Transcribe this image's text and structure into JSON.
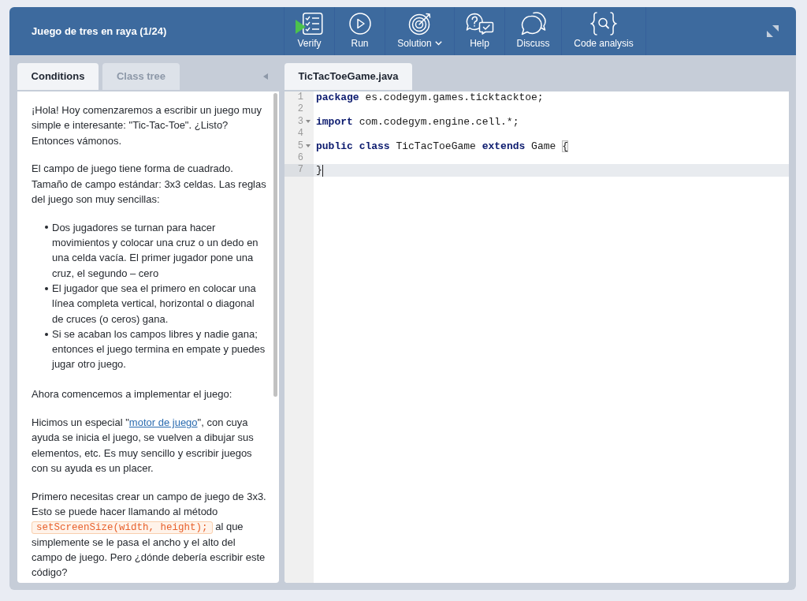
{
  "header": {
    "title": "Juego de tres en raya (1/24)",
    "toolbar": [
      {
        "label": "Verify",
        "kind": "verify",
        "dropdown": false
      },
      {
        "label": "Run",
        "kind": "run",
        "dropdown": false
      },
      {
        "label": "Solution",
        "kind": "solution",
        "dropdown": true
      },
      {
        "label": "Help",
        "kind": "help",
        "dropdown": false
      },
      {
        "label": "Discuss",
        "kind": "discuss",
        "dropdown": false
      },
      {
        "label": "Code analysis",
        "kind": "analysis",
        "dropdown": false
      }
    ]
  },
  "left_panel": {
    "tabs": [
      {
        "label": "Conditions",
        "selected": true
      },
      {
        "label": "Class tree",
        "selected": false
      }
    ],
    "content": [
      {
        "kind": "paragraph",
        "parts": [
          {
            "kind": "text",
            "text": "¡Hola! Hoy comenzaremos a escribir un juego muy simple e interesante: \"Tic-Tac-Toe\". ¿Listo? Entonces vámonos."
          }
        ]
      },
      {
        "kind": "paragraph",
        "parts": [
          {
            "kind": "text",
            "text": "El campo de juego tiene forma de cuadrado. Tamaño de campo estándar: 3x3 celdas. Las reglas del juego son muy sencillas:"
          }
        ]
      },
      {
        "kind": "list",
        "items": [
          "Dos jugadores se turnan para hacer movimientos y colocar una cruz o un dedo en una celda vacía. El primer jugador pone una cruz, el segundo – cero",
          "El jugador que sea el primero en colocar una línea completa vertical, horizontal o diagonal de cruces (o ceros) gana.",
          "Si se acaban los campos libres y nadie gana; entonces el juego termina en empate y puedes jugar otro juego."
        ]
      },
      {
        "kind": "paragraph",
        "parts": [
          {
            "kind": "text",
            "text": "Ahora comencemos a implementar el juego:"
          }
        ]
      },
      {
        "kind": "paragraph",
        "parts": [
          {
            "kind": "text",
            "text": "Hicimos un especial \""
          },
          {
            "kind": "link",
            "text": "motor de juego"
          },
          {
            "kind": "text",
            "text": "\", con cuya ayuda se inicia el juego, se vuelven a dibujar sus elementos, etc. Es muy sencillo y escribir juegos con su ayuda es un placer."
          }
        ]
      },
      {
        "kind": "paragraph",
        "parts": [
          {
            "kind": "text",
            "text": "Primero necesitas crear un campo de juego de 3x3. Esto se puede hacer llamando al método"
          },
          {
            "kind": "code",
            "text": "setScreenSize(width, height);"
          },
          {
            "kind": "text",
            "text": "al que simplemente se le pasa el ancho y el alto del campo de juego. Pero ¿dónde debería escribir este código?"
          }
        ]
      }
    ]
  },
  "editor": {
    "tabs": [
      {
        "label": "TicTacToeGame.java",
        "selected": true
      }
    ],
    "lines": [
      {
        "number": "1",
        "foldable": false,
        "active": false,
        "cursor": false,
        "tokens": [
          {
            "kind": "keyword",
            "text": "package"
          },
          {
            "kind": "plain",
            "text": "es.codegym.games.ticktacktoe;"
          }
        ]
      },
      {
        "number": "2",
        "foldable": false,
        "active": false,
        "cursor": false
      },
      {
        "number": "3",
        "foldable": true,
        "active": false,
        "cursor": false,
        "tokens": [
          {
            "kind": "keyword",
            "text": "import"
          },
          {
            "kind": "plain",
            "text": "com.codegym.engine.cell.*;"
          }
        ]
      },
      {
        "number": "4",
        "foldable": false,
        "active": false,
        "cursor": false
      },
      {
        "number": "5",
        "foldable": true,
        "active": false,
        "cursor": false,
        "tokens": [
          {
            "kind": "keyword",
            "text": "public"
          },
          {
            "kind": "keyword",
            "text": "class"
          },
          {
            "kind": "plain",
            "text": "TicTacToeGame"
          },
          {
            "kind": "keyword",
            "text": "extends"
          },
          {
            "kind": "plain",
            "text": "Game"
          },
          {
            "kind": "bracket",
            "text": "{",
            "matched": true
          }
        ]
      },
      {
        "number": "6",
        "foldable": false,
        "active": false,
        "cursor": false
      },
      {
        "number": "7",
        "foldable": false,
        "active": true,
        "cursor": true,
        "tokens": [
          {
            "kind": "bracket",
            "text": "}",
            "matched": false
          }
        ]
      }
    ]
  }
}
